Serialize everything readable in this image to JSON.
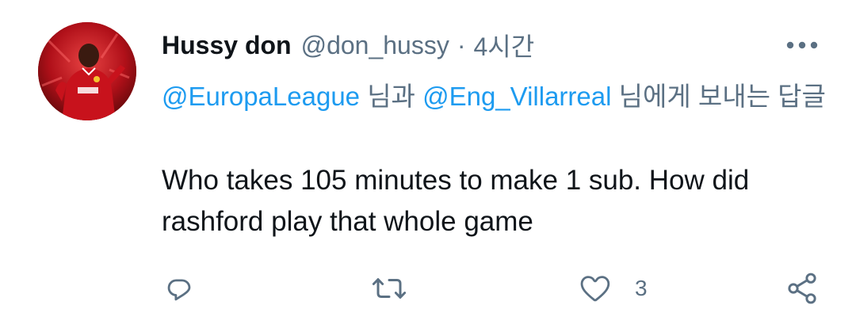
{
  "tweet": {
    "display_name": "Hussy don",
    "handle": "@don_hussy",
    "separator": "·",
    "timestamp": "4시간",
    "reply_context": {
      "mention_1": "@EuropaLeague",
      "connector_1": " 님과 ",
      "mention_2": "@Eng_Villarreal",
      "connector_2": " 님에게 보내는 답글"
    },
    "text": "Who takes 105 minutes to make 1 sub. How did rashford play that whole game"
  },
  "actions": {
    "reply_icon": "reply-icon",
    "retweet_icon": "retweet-icon",
    "like_icon": "heart-icon",
    "like_count": "3",
    "share_icon": "share-icon"
  },
  "colors": {
    "text": "#0f1419",
    "secondary": "#5b7083",
    "link": "#1d9bf0"
  }
}
